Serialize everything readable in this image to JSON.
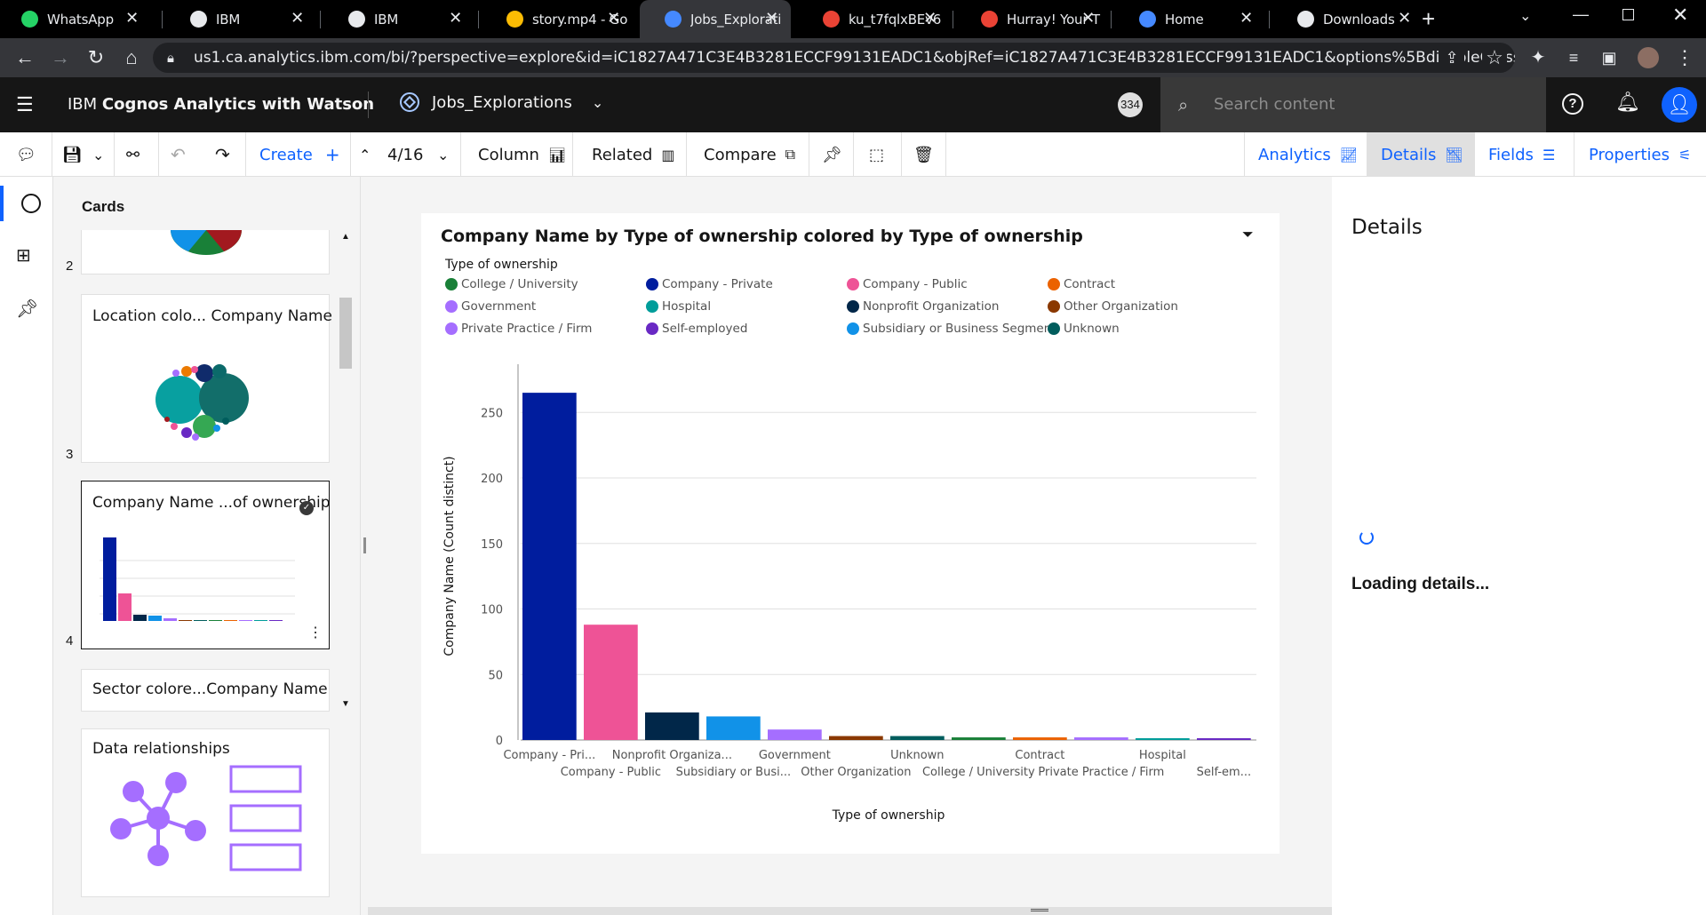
{
  "browser": {
    "tabs": [
      {
        "title": "WhatsApp",
        "icon": "whatsapp-icon",
        "color": "#25d366"
      },
      {
        "title": "IBM",
        "icon": "globe-icon",
        "color": "#e8eaed"
      },
      {
        "title": "IBM",
        "icon": "globe-icon",
        "color": "#e8eaed"
      },
      {
        "title": "story.mp4 - Go",
        "icon": "google-drive-icon",
        "color": "#fbbc04"
      },
      {
        "title": "Jobs_Explorati",
        "icon": "cognos-icon",
        "color": "#4589ff"
      },
      {
        "title": "ku_t7fqlxBEv6",
        "icon": "google-photos-icon",
        "color": "#ea4335"
      },
      {
        "title": "Hurray! Your T",
        "icon": "gmail-icon",
        "color": "#ea4335"
      },
      {
        "title": "Home",
        "icon": "cognos-icon",
        "color": "#4589ff"
      },
      {
        "title": "Downloads",
        "icon": "download-icon",
        "color": "#e8eaed"
      }
    ],
    "url": "us1.ca.analytics.ibm.com/bi/?perspective=explore&id=iC1827A471C3E4B3281ECCF99131EADC1&objRef=iC1827A471C3E4B3281ECCF99131EADC1&options%5BdisableGlassPrefet..."
  },
  "app": {
    "product_prefix": "IBM ",
    "product_name": "Cognos Analytics with Watson",
    "exploration_name": "Jobs_Explorations",
    "badge": "334",
    "search_placeholder": "Search content"
  },
  "toolbar": {
    "create_label": "Create",
    "page_indicator": "4/16",
    "column_label": "Column",
    "related_label": "Related",
    "compare_label": "Compare",
    "tabs": [
      "Analytics",
      "Details",
      "Fields",
      "Properties"
    ]
  },
  "cards_panel": {
    "title": "Cards",
    "cards": [
      {
        "num": "2",
        "title": ""
      },
      {
        "num": "3",
        "title": "Location colo... Company Name"
      },
      {
        "num": "4",
        "title": "Company Name ...of ownership"
      },
      {
        "num": "",
        "title": "Sector colore...Company Name"
      },
      {
        "num": "",
        "title": "Data relationships"
      }
    ]
  },
  "details": {
    "title": "Details",
    "loading": "Loading details..."
  },
  "chart_data": {
    "type": "bar",
    "title": "Company Name by Type of ownership colored by Type of ownership",
    "legend_title": "Type of ownership",
    "legend": [
      {
        "name": "College / University",
        "color": "#198038"
      },
      {
        "name": "Company - Private",
        "color": "#001d9e"
      },
      {
        "name": "Company - Public",
        "color": "#ee5396"
      },
      {
        "name": "Contract",
        "color": "#eb6200"
      },
      {
        "name": "Government",
        "color": "#a56eff"
      },
      {
        "name": "Hospital",
        "color": "#009d9a"
      },
      {
        "name": "Nonprofit Organization",
        "color": "#012749"
      },
      {
        "name": "Other Organization",
        "color": "#8a3800"
      },
      {
        "name": "Private Practice / Firm",
        "color": "#a56eff"
      },
      {
        "name": "Self-employed",
        "color": "#6929c4"
      },
      {
        "name": "Subsidiary or Business Segment",
        "color": "#1192e8"
      },
      {
        "name": "Unknown",
        "color": "#005d5d"
      }
    ],
    "categories": [
      "Company - Pri...",
      "Company - Public",
      "Nonprofit Organiza...",
      "Subsidiary or Busi...",
      "Government",
      "Other Organization",
      "Unknown",
      "College / University",
      "Contract",
      "Private Practice / Firm",
      "Hospital",
      "Self-em..."
    ],
    "values": [
      265,
      88,
      21,
      18,
      8,
      3,
      3,
      2,
      2,
      2,
      1,
      1
    ],
    "colors": [
      "#001d9e",
      "#ee5396",
      "#012749",
      "#1192e8",
      "#a56eff",
      "#8a3800",
      "#005d5d",
      "#198038",
      "#eb6200",
      "#a56eff",
      "#009d9a",
      "#6929c4"
    ],
    "xlabel": "Type of ownership",
    "ylabel": "Company Name (Count distinct)",
    "yticks": [
      0,
      50,
      100,
      150,
      200,
      250
    ],
    "ylim": [
      0,
      280
    ],
    "grid": true,
    "legend_position": "top-left"
  }
}
